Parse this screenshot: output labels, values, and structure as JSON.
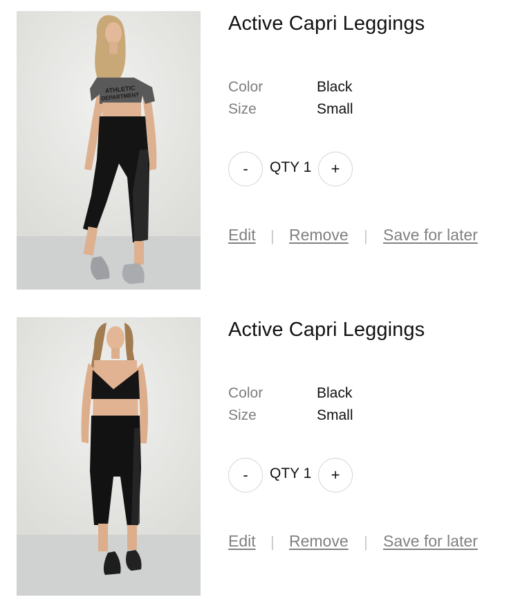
{
  "cart": {
    "items": [
      {
        "title": "Active Capri Leggings",
        "color_label": "Color",
        "color_value": "Black",
        "size_label": "Size",
        "size_value": "Small",
        "qty_minus": "-",
        "qty_text": "QTY 1",
        "qty_plus": "+",
        "edit": "Edit",
        "remove": "Remove",
        "save_for_later": "Save for later",
        "separator": "|",
        "image_alt": "Model wearing grey crop top and black capri leggings",
        "top_print_line1": "ATHLETIC",
        "top_print_line2": "DEPARTMENT"
      },
      {
        "title": "Active Capri Leggings",
        "color_label": "Color",
        "color_value": "Black",
        "size_label": "Size",
        "size_value": "Small",
        "qty_minus": "-",
        "qty_text": "QTY 1",
        "qty_plus": "+",
        "edit": "Edit",
        "remove": "Remove",
        "save_for_later": "Save for later",
        "separator": "|",
        "image_alt": "Model wearing black sports bra and black capri leggings"
      }
    ]
  },
  "colors": {
    "label_grey": "#7d7d7d",
    "link_grey": "#808080",
    "circle_border": "#d4d4d4",
    "text": "#111111"
  }
}
